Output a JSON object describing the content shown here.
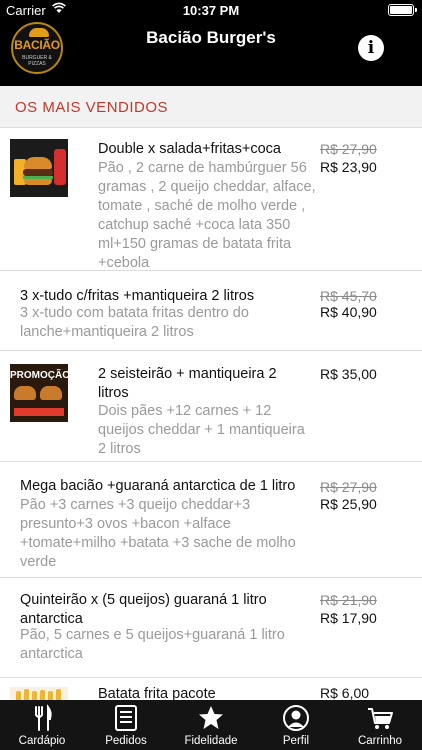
{
  "status_bar": {
    "carrier": "Carrier",
    "time": "10:37 PM"
  },
  "header": {
    "logo_text": "BACIÃO",
    "logo_subtext": "BURGUER & PIZZAS",
    "title": "Bacião Burger's"
  },
  "section": {
    "title": "OS MAIS VENDIDOS"
  },
  "items": [
    {
      "name": "Double x salada+fritas+coca",
      "description": "Pão , 2 carne de hambúrguer 56 gramas , 2 queijo cheddar, alface, tomate , saché de molho verde , catchup saché +coca lata 350 ml+150 gramas de batata frita +cebola",
      "old_price": "R$ 27,90",
      "price": "R$ 23,90",
      "image": "burger-combo-photo"
    },
    {
      "name": "3 x-tudo c/fritas +mantiqueira 2 litros",
      "description": "3 x-tudo com batata fritas dentro do lanche+mantiqueira 2 litros",
      "old_price": "R$ 45,70",
      "price": "R$ 40,90"
    },
    {
      "name": "2 seisteirão + mantiqueira 2 litros",
      "description": "Dois pães +12 carnes + 12 queijos cheddar + 1 mantiqueira 2 litros",
      "price": "R$ 35,00",
      "image": "promo-photo",
      "image_text": "PROMOÇÃO"
    },
    {
      "name": "Mega bacião +guaraná antarctica de 1 litro",
      "description": "Pão +3 carnes +3 queijo cheddar+3 presunto+3 ovos +bacon +alface +tomate+milho +batata +3 sache de molho verde",
      "old_price": "R$ 27,90",
      "price": "R$ 25,90"
    },
    {
      "name": "Quinteirão x (5 queijos)  guaraná 1 litro antarctica",
      "description": "Pão,  5 carnes e 5 queijos+guaraná 1 litro antarctica",
      "old_price": "R$ 21,90",
      "price": "R$ 17,90"
    },
    {
      "name": "Batata frita pacote",
      "price": "R$ 6,00",
      "image": "fries-photo"
    }
  ],
  "tabs": [
    {
      "label": "Cardápio",
      "icon": "fork-knife-icon"
    },
    {
      "label": "Pedidos",
      "icon": "list-icon"
    },
    {
      "label": "Fidelidade",
      "icon": "star-icon"
    },
    {
      "label": "Perfil",
      "icon": "user-icon"
    },
    {
      "label": "Carrinho",
      "icon": "cart-icon"
    }
  ]
}
